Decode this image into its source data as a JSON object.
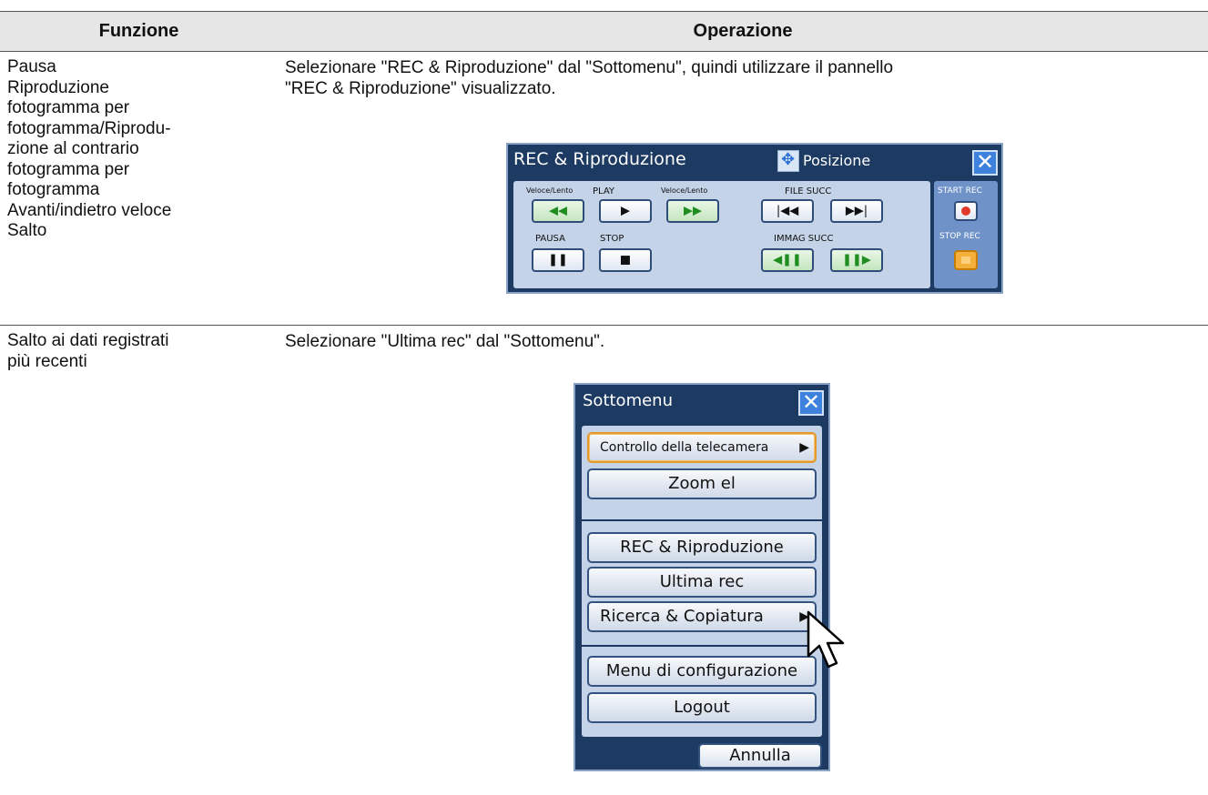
{
  "table": {
    "headers": {
      "function": "Funzione",
      "operation": "Operazione"
    },
    "rows": [
      {
        "function_lines": [
          "Pausa",
          "Riproduzione",
          "fotogramma per",
          "fotogramma/Riprodu-",
          "zione al contrario",
          "fotogramma per",
          "fotogramma",
          "Avanti/indietro veloce",
          "Salto"
        ],
        "operation_lines": [
          "Selezionare \"REC & Riproduzione\" dal \"Sottomenu\", quindi utilizzare il pannello",
          "\"REC & Riproduzione\" visualizzato."
        ]
      },
      {
        "function_lines": [
          "Salto ai dati registrati",
          "più recenti"
        ],
        "operation_lines": [
          "Selezionare \"Ultima rec\" dal \"Sottomenu\"."
        ]
      }
    ]
  },
  "rec_panel": {
    "title": "REC & Riproduzione",
    "position_label": "Posizione",
    "close_glyph": "✕",
    "labels": {
      "veloce_lento_1": "Veloce/Lento",
      "play": "PLAY",
      "veloce_lento_2": "Veloce/Lento",
      "file_succ": "FILE SUCC",
      "pausa": "PAUSA",
      "stop": "STOP",
      "immag_succ": "IMMAG SUCC",
      "start_rec": "START REC",
      "stop_rec": "STOP REC"
    },
    "glyphs": {
      "rewind": "◀◀",
      "play": "▶",
      "fast_forward": "▶▶",
      "prev_file": "|◀◀",
      "next_file": "▶▶|",
      "pause": "❚❚",
      "stop": "■",
      "prev_frame": "◀❚❚",
      "next_frame": "❚❚▶"
    }
  },
  "sottomenu": {
    "title": "Sottomenu",
    "close_glyph": "✕",
    "items": [
      {
        "label": "Controllo della telecamera",
        "arrow": "▶"
      },
      {
        "label": "Zoom el"
      },
      {
        "label": "REC & Riproduzione"
      },
      {
        "label": "Ultima rec"
      },
      {
        "label": "Ricerca & Copiatura",
        "arrow": "▶"
      },
      {
        "label": "Menu di configurazione"
      },
      {
        "label": "Logout"
      }
    ],
    "cancel_label": "Annulla"
  },
  "icons": {
    "cursor": "pointer-arrow-icon",
    "position": "move-arrows-icon"
  }
}
